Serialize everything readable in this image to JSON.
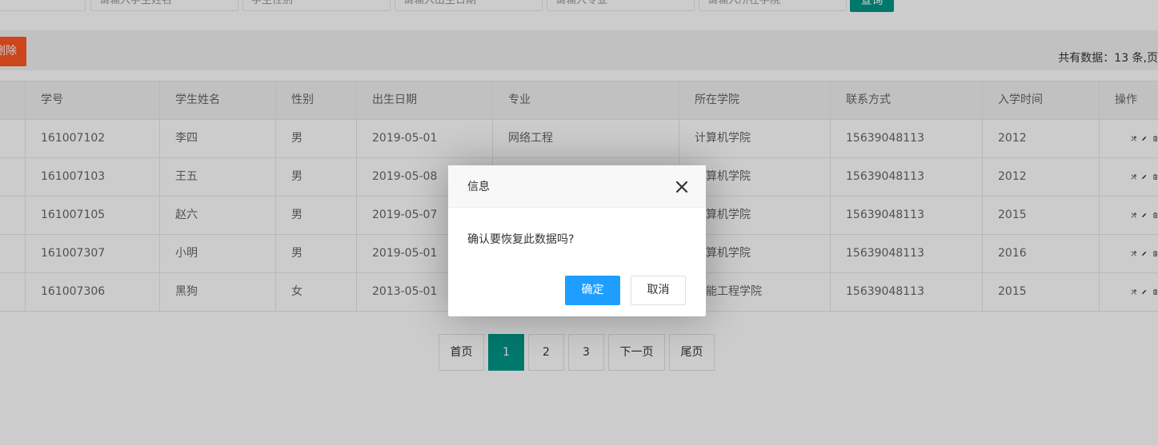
{
  "toolbar": {
    "delete_label": "删除",
    "total_text": "共有数据：13 条,页"
  },
  "query_label": "查询",
  "filters": [
    "",
    "请输入学生姓名",
    "学生性别",
    "请输入出生日期",
    "请输入专业",
    "请输入所在学院"
  ],
  "table": {
    "headers": [
      "学号",
      "学生姓名",
      "性别",
      "出生日期",
      "专业",
      "所在学院",
      "联系方式",
      "入学时间",
      "操作"
    ],
    "rows": [
      [
        "161007102",
        "李四",
        "男",
        "2019-05-01",
        "网络工程",
        "计算机学院",
        "15639048113",
        "2012"
      ],
      [
        "161007103",
        "王五",
        "男",
        "2019-05-08",
        "",
        "计算机学院",
        "15639048113",
        "2012"
      ],
      [
        "161007105",
        "赵六",
        "男",
        "2019-05-07",
        "",
        "计算机学院",
        "15639048113",
        "2015"
      ],
      [
        "161007307",
        "小明",
        "男",
        "2019-05-01",
        "",
        "计算机学院",
        "15639048113",
        "2016"
      ],
      [
        "161007306",
        "黑狗",
        "女",
        "2013-05-01",
        "",
        "智能工程学院",
        "15639048113",
        "2015"
      ]
    ],
    "row_actions": [
      "wrench-icon",
      "edit-icon",
      "trash-icon"
    ]
  },
  "pagination": {
    "first": "首页",
    "pages": [
      "1",
      "2",
      "3"
    ],
    "current": "1",
    "next": "下一页",
    "last": "尾页"
  },
  "dialog": {
    "title": "信息",
    "message": "确认要恢复此数据吗?",
    "confirm": "确定",
    "cancel": "取消"
  },
  "colors": {
    "primary": "#009688",
    "danger": "#ff5722",
    "confirm": "#1e9fff"
  }
}
